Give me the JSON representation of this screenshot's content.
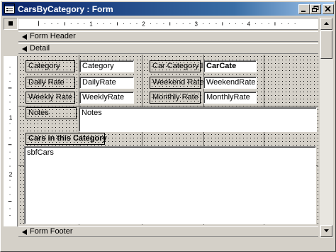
{
  "window": {
    "title": "CarsByCategory : Form",
    "controls": [
      "minimize-icon",
      "restore-icon",
      "close-icon"
    ]
  },
  "ruler": {
    "horizontal_numbers": [
      "1",
      "2",
      "3",
      "4"
    ],
    "vertical_numbers": [
      "1",
      "2"
    ]
  },
  "sections": {
    "form_header": "Form Header",
    "detail": "Detail",
    "form_footer": "Form Footer"
  },
  "fields": {
    "category_label": "Category",
    "category_box": "Category",
    "daily_rate_label": "Daily Rate",
    "daily_rate_box": "DailyRate",
    "weekly_rate_label": "Weekly Rate",
    "weekly_rate_box": "WeeklyRate",
    "car_category_id_label": "Car Category ID",
    "car_category_id_box": "CarCate",
    "weekend_rate_label": "Weekend Rate",
    "weekend_rate_box": "WeekendRate",
    "monthly_rate_label": "Monthly Rate",
    "monthly_rate_box": "MonthlyRate",
    "notes_label": "Notes",
    "notes_box": "Notes",
    "subform_label": "Cars in this Category",
    "subform_box": "sbfCars"
  },
  "colors": {
    "title_gradient_start": "#0a246a",
    "title_gradient_end": "#a6caf0",
    "face": "#d4d0c8"
  }
}
